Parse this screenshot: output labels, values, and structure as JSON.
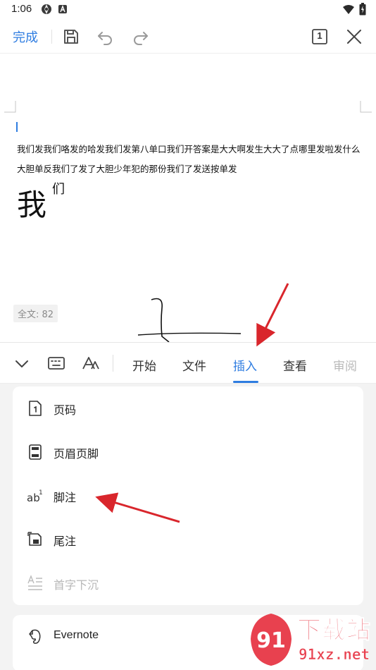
{
  "status_bar": {
    "time": "1:06",
    "left_icons": [
      "aperture-icon",
      "notification-a-icon"
    ],
    "right_icons": [
      "wifi-icon",
      "battery-icon"
    ]
  },
  "toolbar": {
    "done_label": "完成",
    "icons": [
      "save-icon",
      "undo-icon",
      "redo-icon",
      "page-count-icon",
      "close-icon"
    ],
    "page_indicator": "1",
    "accent_color": "#2f7de1"
  },
  "document": {
    "lines": [
      "我们发我们咯发的哈发我们发第八单口我们开答案是大大啊发生大大了点哪里发啦发什么",
      "大胆单反我们了发了大胆少年犯的那份我们了发送按单发"
    ],
    "big_char": "我",
    "superscript_char": "们",
    "word_count": "全文: 82"
  },
  "panel": {
    "left_icons": [
      "collapse-chevron-icon",
      "keyboard-icon",
      "font-style-icon"
    ],
    "tabs": [
      {
        "label": "开始",
        "state": "normal"
      },
      {
        "label": "文件",
        "state": "normal"
      },
      {
        "label": "插入",
        "state": "active"
      },
      {
        "label": "查看",
        "state": "normal"
      },
      {
        "label": "审阅",
        "state": "faded"
      }
    ],
    "insert_items": [
      {
        "label": "页码",
        "icon": "page-number-icon",
        "enabled": true
      },
      {
        "label": "页眉页脚",
        "icon": "header-footer-icon",
        "enabled": true
      },
      {
        "label": "脚注",
        "icon": "footnote-icon",
        "enabled": true
      },
      {
        "label": "尾注",
        "icon": "endnote-icon",
        "enabled": true
      },
      {
        "label": "首字下沉",
        "icon": "drop-cap-icon",
        "enabled": false
      }
    ],
    "evernote_label": "Evernote"
  },
  "watermark": {
    "brand_text": "下载站",
    "url_text": "91xz.net",
    "logo_text": "91"
  },
  "colors": {
    "accent": "#2f7de1",
    "annotation_arrow": "#d9262c",
    "panel_bg": "#f3f3f3"
  }
}
